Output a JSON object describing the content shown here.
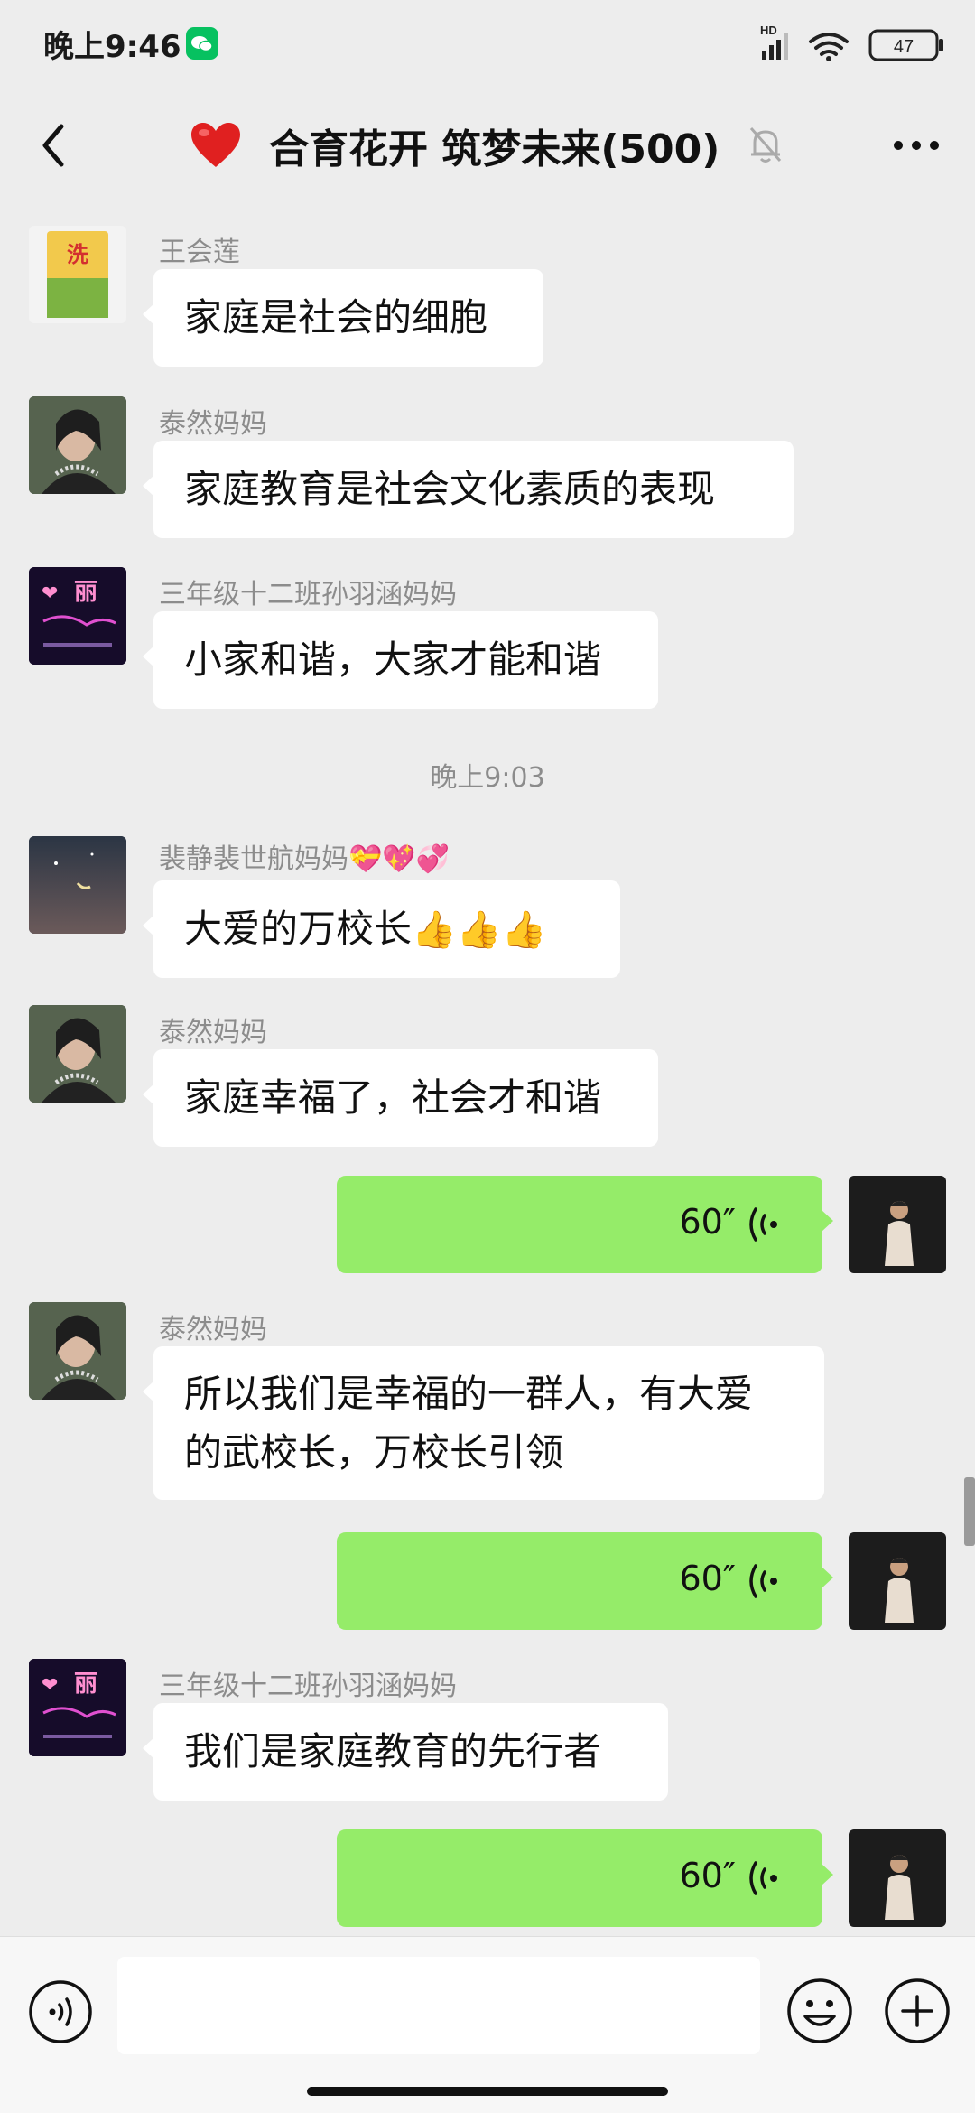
{
  "status_bar": {
    "time": "晚上9:46",
    "battery": "47",
    "network": "HD"
  },
  "header": {
    "title": "合育花开 筑梦未来(500)"
  },
  "messages": [
    {
      "type": "text",
      "sender": "王会莲",
      "text": "家庭是社会的细胞"
    },
    {
      "type": "text",
      "sender": "泰然妈妈",
      "text": "家庭教育是社会文化素质的表现"
    },
    {
      "type": "text",
      "sender": "三年级十二班孙羽涵妈妈",
      "text": "小家和谐，大家才能和谐"
    },
    {
      "type": "time",
      "text": "晚上9:03"
    },
    {
      "type": "text",
      "sender": "裴静裴世航妈妈💝💖💞",
      "text": "大爱的万校长",
      "emoji": "👍👍👍"
    },
    {
      "type": "text",
      "sender": "泰然妈妈",
      "text": "家庭幸福了，社会才和谐"
    },
    {
      "type": "voice",
      "duration": "60″"
    },
    {
      "type": "text",
      "sender": "泰然妈妈",
      "lines": [
        "所以我们是幸福的一群人，有大爱",
        "的武校长，万校长引领"
      ]
    },
    {
      "type": "voice",
      "duration": "60″"
    },
    {
      "type": "text",
      "sender": "三年级十二班孙羽涵妈妈",
      "text": "我们是家庭教育的先行者"
    },
    {
      "type": "voice",
      "duration": "60″"
    }
  ],
  "input": {
    "placeholder": ""
  },
  "colors": {
    "self_bubble": "#95ec69",
    "background": "#ededed",
    "wechat": "#07c160"
  }
}
